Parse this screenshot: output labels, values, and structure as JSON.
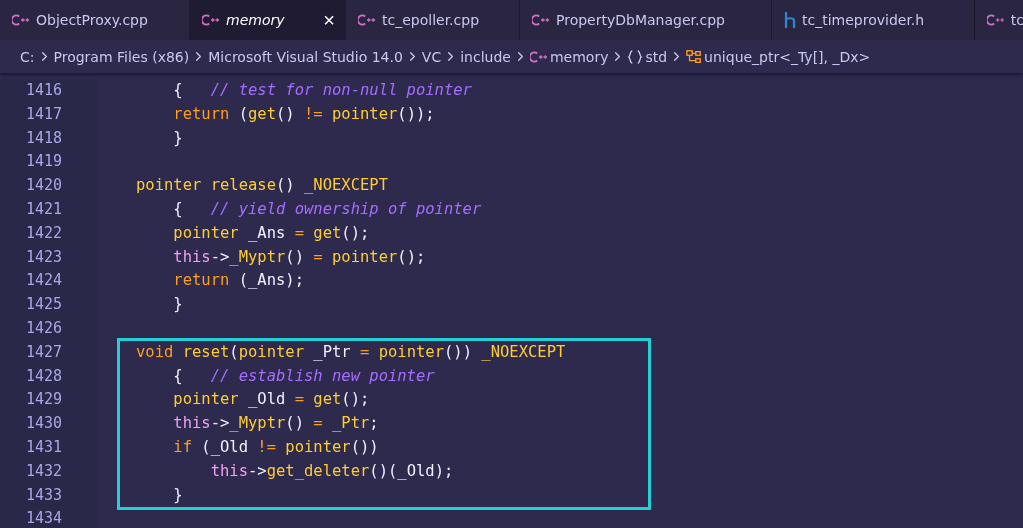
{
  "tabs": [
    {
      "label": "ObjectProxy.cpp",
      "kind": "cpp",
      "selected": false
    },
    {
      "label": "memory",
      "kind": "cpp",
      "selected": true,
      "close": "×"
    },
    {
      "label": "tc_epoller.cpp",
      "kind": "cpp",
      "selected": false
    },
    {
      "label": "PropertyDbManager.cpp",
      "kind": "cpp",
      "selected": false
    },
    {
      "label": "tc_timeprovider.h",
      "kind": "header",
      "selected": false
    },
    {
      "label": "tc",
      "kind": "cpp",
      "selected": false
    }
  ],
  "breadcrumb": [
    {
      "label": "C:",
      "kind": "folder"
    },
    {
      "label": "Program Files (x86)",
      "kind": "folder"
    },
    {
      "label": "Microsoft Visual Studio 14.0",
      "kind": "folder"
    },
    {
      "label": "VC",
      "kind": "folder"
    },
    {
      "label": "include",
      "kind": "folder"
    },
    {
      "label": "memory",
      "kind": "cpp"
    },
    {
      "label": "std",
      "kind": "namespace"
    },
    {
      "label": "unique_ptr<_Ty[], _Dx>",
      "kind": "class"
    }
  ],
  "blocks": [
    {
      "boxed": false,
      "lines": [
        {
          "number": "1416",
          "tokens": [
            {
              "kind": "plain",
              "text": "    {   "
            },
            {
              "kind": "comment",
              "text": "// test for non-null pointer"
            }
          ]
        },
        {
          "number": "1417",
          "tokens": [
            {
              "kind": "kw",
              "text": "    return "
            },
            {
              "kind": "plain",
              "text": "("
            },
            {
              "kind": "fn",
              "text": "get"
            },
            {
              "kind": "plain",
              "text": "() "
            },
            {
              "kind": "kw",
              "text": "!="
            },
            {
              "kind": "fn",
              "text": " pointer"
            },
            {
              "kind": "plain",
              "text": "());"
            }
          ]
        },
        {
          "number": "1418",
          "tokens": [
            {
              "kind": "plain",
              "text": "    }"
            }
          ]
        },
        {
          "number": "1419"
        },
        {
          "number": "1420",
          "tokens": [
            {
              "kind": "fn",
              "text": "pointer release"
            },
            {
              "kind": "plain",
              "text": "() "
            },
            {
              "kind": "fn",
              "text": "_NOEXCEPT"
            }
          ]
        },
        {
          "number": "1421",
          "tokens": [
            {
              "kind": "plain",
              "text": "    {   "
            },
            {
              "kind": "comment",
              "text": "// yield ownership of pointer"
            }
          ]
        },
        {
          "number": "1422",
          "tokens": [
            {
              "kind": "fn",
              "text": "    pointer "
            },
            {
              "kind": "plain",
              "text": "_Ans "
            },
            {
              "kind": "kw",
              "text": "="
            },
            {
              "kind": "fn",
              "text": " get"
            },
            {
              "kind": "plain",
              "text": "();"
            }
          ]
        },
        {
          "number": "1423",
          "tokens": [
            {
              "kind": "this",
              "text": "    this"
            },
            {
              "kind": "plain",
              "text": "->"
            },
            {
              "kind": "fn",
              "text": "_Myptr"
            },
            {
              "kind": "plain",
              "text": "() "
            },
            {
              "kind": "kw",
              "text": "="
            },
            {
              "kind": "fn",
              "text": " pointer"
            },
            {
              "kind": "plain",
              "text": "();"
            }
          ]
        },
        {
          "number": "1424",
          "tokens": [
            {
              "kind": "kw",
              "text": "    return "
            },
            {
              "kind": "plain",
              "text": "(_Ans);"
            }
          ]
        },
        {
          "number": "1425",
          "tokens": [
            {
              "kind": "plain",
              "text": "    }"
            }
          ]
        },
        {
          "number": "1426"
        }
      ]
    },
    {
      "boxed": true,
      "lines": [
        {
          "number": "1427",
          "tokens": [
            {
              "kind": "kw",
              "text": "void "
            },
            {
              "kind": "fn",
              "text": "reset"
            },
            {
              "kind": "plain",
              "text": "("
            },
            {
              "kind": "fn",
              "text": "pointer "
            },
            {
              "kind": "plain",
              "text": "_Ptr "
            },
            {
              "kind": "kw",
              "text": "="
            },
            {
              "kind": "fn",
              "text": " pointer"
            },
            {
              "kind": "plain",
              "text": "()) "
            },
            {
              "kind": "fn",
              "text": "_NOEXCEPT"
            }
          ]
        },
        {
          "number": "1428",
          "tokens": [
            {
              "kind": "plain",
              "text": "    {   "
            },
            {
              "kind": "comment",
              "text": "// establish new pointer"
            }
          ]
        },
        {
          "number": "1429",
          "tokens": [
            {
              "kind": "fn",
              "text": "    pointer "
            },
            {
              "kind": "plain",
              "text": "_Old "
            },
            {
              "kind": "kw",
              "text": "="
            },
            {
              "kind": "fn",
              "text": " get"
            },
            {
              "kind": "plain",
              "text": "();"
            }
          ]
        },
        {
          "number": "1430",
          "tokens": [
            {
              "kind": "this",
              "text": "    this"
            },
            {
              "kind": "plain",
              "text": "->"
            },
            {
              "kind": "fn",
              "text": "_Myptr"
            },
            {
              "kind": "plain",
              "text": "() "
            },
            {
              "kind": "kw",
              "text": "="
            },
            {
              "kind": "fn",
              "text": " _Ptr"
            },
            {
              "kind": "plain",
              "text": ";"
            }
          ]
        },
        {
          "number": "1431",
          "tokens": [
            {
              "kind": "kw",
              "text": "    if "
            },
            {
              "kind": "plain",
              "text": "(_Old "
            },
            {
              "kind": "kw",
              "text": "!="
            },
            {
              "kind": "fn",
              "text": " pointer"
            },
            {
              "kind": "plain",
              "text": "())"
            }
          ]
        },
        {
          "number": "1432",
          "tokens": [
            {
              "kind": "this",
              "text": "        this"
            },
            {
              "kind": "plain",
              "text": "->"
            },
            {
              "kind": "fn",
              "text": "get_deleter"
            },
            {
              "kind": "plain",
              "text": "()(_Old);"
            }
          ]
        },
        {
          "number": "1433",
          "tokens": [
            {
              "kind": "plain",
              "text": "    }"
            }
          ]
        }
      ]
    },
    {
      "boxed": false,
      "lines": [
        {
          "number": "1434"
        }
      ]
    }
  ]
}
